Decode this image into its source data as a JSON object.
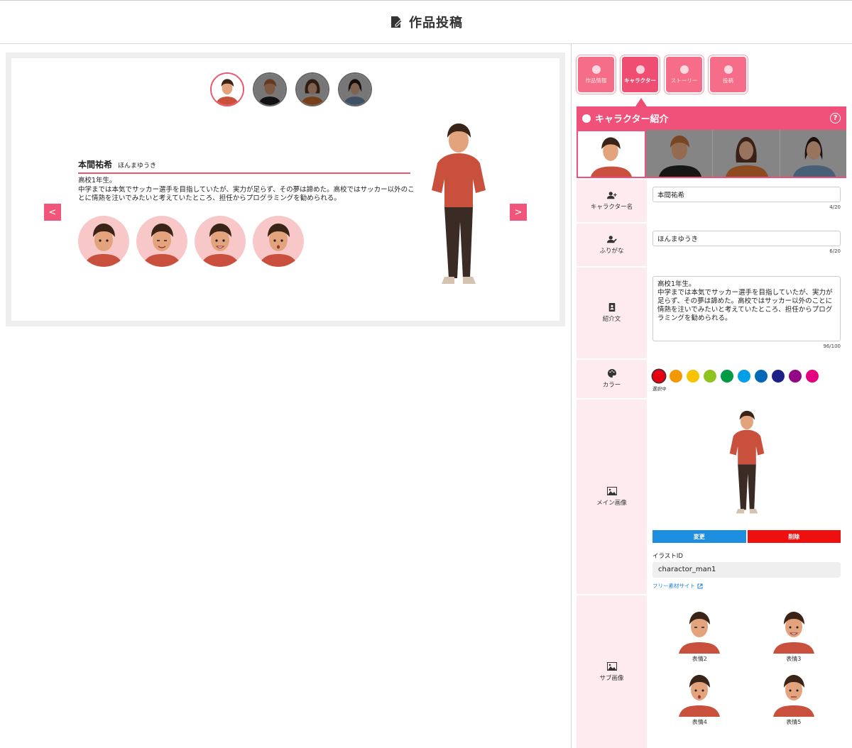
{
  "header": {
    "title": "作品投稿"
  },
  "preview": {
    "name": "本間祐希",
    "kana": "ほんまゆうき",
    "intro": "高校1年生。\n中学までは本気でサッカー選手を目指していたが、実力が足らず、その夢は諦めた。高校ではサッカー以外のことに情熱を注いでみたいと考えていたところ、担任からプログラミングを勧められる。",
    "prev_label": "<",
    "next_label": ">"
  },
  "tabs": [
    {
      "label": "作品情報",
      "icon": "info-icon"
    },
    {
      "label": "キャラクター",
      "icon": "smile-icon"
    },
    {
      "label": "ストーリー",
      "icon": "book-icon"
    },
    {
      "label": "投稿",
      "icon": "upload-icon"
    }
  ],
  "section": {
    "title": "キャラクター紹介",
    "help": "?"
  },
  "form": {
    "name_label": "キャラクター名",
    "name_value": "本間祐希",
    "name_counter": "4/20",
    "kana_label": "ふりがな",
    "kana_value": "ほんまゆうき",
    "kana_counter": "6/20",
    "intro_label": "紹介文",
    "intro_value": "高校1年生。\n中学までは本気でサッカー選手を目指していたが、実力が足らず、その夢は諦めた。高校ではサッカー以外のことに情熱を注いでみたいと考えていたところ、担任からプログラミングを勧められる。",
    "intro_counter": "96/100",
    "color_label": "カラー",
    "selected_note": "選択中",
    "colors": [
      "#e60012",
      "#f39800",
      "#f8c300",
      "#8fc31f",
      "#009944",
      "#00a0e9",
      "#0068b7",
      "#1d2088",
      "#920783",
      "#e4007f"
    ],
    "main_image_label": "メイン画像",
    "change_label": "変更",
    "delete_label": "削除",
    "illust_id_label": "イラストID",
    "illust_id_value": "charactor_man1",
    "free_site_label": "フリー素材サイト",
    "sub_image_label": "サブ画像",
    "sub_captions": [
      "表情2",
      "表情3",
      "表情4",
      "表情5"
    ]
  }
}
